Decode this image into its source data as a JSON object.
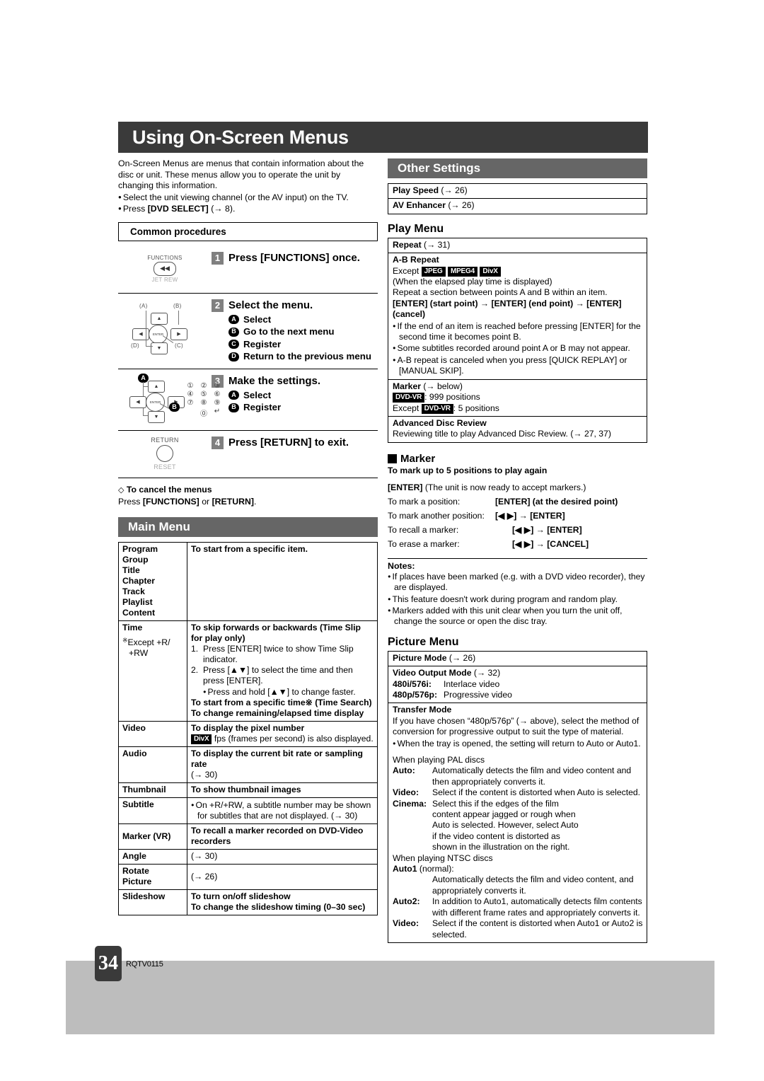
{
  "page": {
    "title": "Using On-Screen Menus",
    "number": "34",
    "doc_id": "RQTV0115"
  },
  "intro": {
    "paragraph": "On-Screen Menus are menus that contain information about the disc or unit. These menus allow you to operate the unit by changing this information.",
    "bullet1": "Select the unit viewing channel (or the AV input) on the TV.",
    "bullet2_pre": "Press ",
    "bullet2_key": "[DVD SELECT]",
    "bullet2_post": " (→ 8)."
  },
  "common_procedures": {
    "heading": "Common procedures",
    "steps": [
      {
        "num": "1",
        "text": "Press [FUNCTIONS] once.",
        "art_top_label": "FUNCTIONS",
        "art_bottom_label": "JET REW",
        "art_glyph": "◀◀"
      },
      {
        "num": "2",
        "text": "Select the menu.",
        "items": [
          {
            "tag": "A",
            "label": "Select"
          },
          {
            "tag": "B",
            "label": "Go to the next menu"
          },
          {
            "tag": "C",
            "label": "Register"
          },
          {
            "tag": "D",
            "label": "Return to the previous menu"
          }
        ],
        "callouts": {
          "a": "(A)",
          "b": "(B)",
          "c": "(C)",
          "d": "(D)"
        },
        "enter_label": "ENTER"
      },
      {
        "num": "3",
        "text": "Make the settings.",
        "items": [
          {
            "tag": "A",
            "label": "Select"
          },
          {
            "tag": "B",
            "label": "Register"
          }
        ],
        "keypad": [
          "①",
          "②",
          "③",
          "④",
          "⑤",
          "⑥",
          "⑦",
          "⑧",
          "⑨",
          "⓪",
          "↵"
        ],
        "enter_label": "ENTER"
      },
      {
        "num": "4",
        "text": "Press [RETURN] to exit.",
        "art_top_label": "RETURN",
        "art_bottom_label": "RESET"
      }
    ],
    "cancel": {
      "heading": "To cancel the menus",
      "line_pre": "Press ",
      "key1": "[FUNCTIONS]",
      "mid": " or ",
      "key2": "[RETURN]",
      "post": "."
    }
  },
  "main_menu": {
    "heading": "Main Menu",
    "rows": [
      {
        "label_lines": [
          "Program",
          "Group",
          "Title",
          "Chapter",
          "Track",
          "Playlist",
          "Content"
        ],
        "desc_bold": "To start from a specific item."
      },
      {
        "label_lines": [
          "Time"
        ],
        "label_note_mark": "※",
        "label_note": "Except +R/",
        "label_note2": "+RW",
        "desc_title": "To skip forwards or backwards (Time Slip for play only)",
        "step1_num": "1.",
        "step1": "Press [ENTER] twice to show Time Slip indicator.",
        "step2_num": "2.",
        "step2": "Press [▲▼] to select the time and then press [ENTER].",
        "step2_sub": "Press and hold [▲▼] to change faster.",
        "desc_tail1": "To start from a specific time※ (Time Search)",
        "desc_tail2": "To change remaining/elapsed time display"
      },
      {
        "label_lines": [
          "Video"
        ],
        "desc_bold": "To display the pixel number",
        "badge": "DivX",
        "desc_after_badge": " fps (frames per second) is also displayed."
      },
      {
        "label_lines": [
          "Audio"
        ],
        "desc_bold": "To display the current bit rate or sampling rate",
        "desc_tail": "(→ 30)"
      },
      {
        "label_lines": [
          "Thumbnail"
        ],
        "desc_bold": "To show thumbnail images"
      },
      {
        "label_lines": [
          "Subtitle"
        ],
        "bullet": "On +R/+RW, a subtitle number may be shown for subtitles that are not displayed. (→ 30)"
      },
      {
        "label_lines": [
          "Marker (VR)"
        ],
        "desc_bold": "To recall a marker recorded on DVD-Video recorders"
      },
      {
        "label_lines": [
          "Angle"
        ],
        "desc_plain": "(→ 30)"
      },
      {
        "label_lines": [
          "Rotate",
          "Picture"
        ],
        "desc_plain": "(→ 26)"
      },
      {
        "label_lines": [
          "Slideshow"
        ],
        "desc_bold": "To turn on/off slideshow",
        "desc_bold2": "To change the slideshow timing (0–30 sec)"
      }
    ]
  },
  "other_settings": {
    "heading": "Other Settings",
    "rows": [
      {
        "label": "Play Speed",
        "ref": " (→ 26)"
      },
      {
        "label": "AV Enhancer",
        "ref": " (→ 26)"
      }
    ]
  },
  "play_menu": {
    "heading": "Play Menu",
    "repeat": {
      "label": "Repeat",
      "ref": " (→ 31)"
    },
    "ab_repeat": {
      "title": "A-B Repeat",
      "except_label": "Except ",
      "badges": [
        "JPEG",
        "MPEG4",
        "DivX"
      ],
      "line_paren": "(When the elapsed play time is displayed)",
      "line_desc": "Repeat a section between points A and B within an item.",
      "sequence": "[ENTER] (start point) → [ENTER] (end point) → [ENTER] (cancel)",
      "bullets": [
        "If the end of an item is reached before pressing [ENTER] for the second time it becomes point B.",
        "Some subtitles recorded around point A or B may not appear.",
        "A-B repeat is canceled when you press [QUICK REPLAY] or [MANUAL SKIP]."
      ]
    },
    "marker_row": {
      "label": "Marker",
      "ref": " (→ below)",
      "badge1": "DVD-VR",
      "line1": ": 999 positions",
      "except_pre": "Except ",
      "badge2": "DVD-VR",
      "line2": ": 5 positions"
    },
    "advanced_disc_review": {
      "title": "Advanced Disc Review",
      "text": "Reviewing title to play Advanced Disc Review. (→ 27, 37)"
    }
  },
  "marker_section": {
    "heading": "Marker",
    "subheading": "To mark up to 5 positions to play again",
    "enter_line_key": "[ENTER]",
    "enter_line_rest": " (The unit is now ready to accept markers.)",
    "lines": [
      {
        "label": "To mark a position:",
        "value": "[ENTER] (at the desired point)",
        "indent": true
      },
      {
        "label": "To mark another position:",
        "value": "[◀ ▶] → [ENTER]",
        "indent": false
      },
      {
        "label": "To recall a marker:",
        "value": "[◀ ▶] → [ENTER]",
        "indent": true
      },
      {
        "label": "To erase a marker:",
        "value": "[◀ ▶] → [CANCEL]",
        "indent": true
      }
    ]
  },
  "notes": {
    "title": "Notes:",
    "items": [
      "If places have been marked (e.g. with a DVD video recorder), they are displayed.",
      "This feature doesn't work during program and random play.",
      "Markers added with this unit clear when you turn the unit off, change the source or open the disc tray."
    ]
  },
  "picture_menu": {
    "heading": "Picture Menu",
    "picture_mode": {
      "label": "Picture Mode",
      "ref": " (→ 26)"
    },
    "video_output_mode": {
      "label": "Video Output Mode",
      "ref": " (→ 32)",
      "rows": [
        {
          "k": "480i/576i:",
          "v": "Interlace video"
        },
        {
          "k": "480p/576p:",
          "v": "Progressive video"
        }
      ]
    },
    "transfer_mode": {
      "title": "Transfer Mode",
      "intro": "If you have chosen “480p/576p” (→ above), select the method of conversion for progressive output to suit the type of material.",
      "bullet": "When the tray is opened, the setting will return to Auto or Auto1.",
      "pal_heading": "When playing PAL discs",
      "pal_rows": [
        {
          "k": "Auto:",
          "v": "Automatically detects the film and video content and then appropriately converts it."
        },
        {
          "k": "Video:",
          "v": "Select if the content is distorted when Auto is selected."
        },
        {
          "k": "Cinema:",
          "v": "Select this if the edges of the film content appear jagged or rough when Auto is selected. However, select Auto if the video content is distorted as shown in the illustration on the right."
        }
      ],
      "ntsc_heading": "When playing NTSC discs",
      "ntsc_auto1_key": "Auto1",
      "ntsc_auto1_suffix": " (normal):",
      "ntsc_auto1_value": "Automatically detects the film and video content, and appropriately converts it.",
      "ntsc_rows": [
        {
          "k": "Auto2:",
          "v": "In addition to Auto1, automatically detects film contents with different frame rates and appropriately converts it."
        },
        {
          "k": "Video:",
          "v": "Select if the content is distorted when Auto1 or Auto2 is selected."
        }
      ]
    }
  }
}
